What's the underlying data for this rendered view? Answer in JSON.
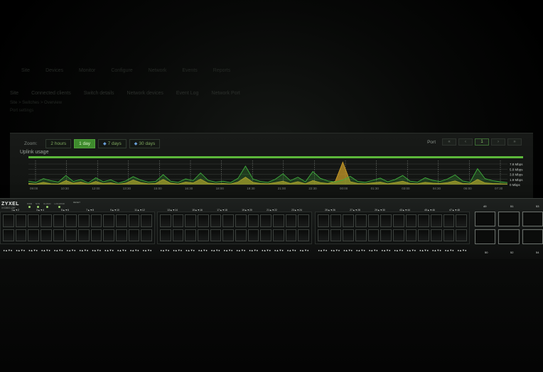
{
  "background_nav": {
    "items": [
      "Site",
      "Devices",
      "Monitor",
      "Configure",
      "Network",
      "Events",
      "Reports"
    ],
    "tabs": [
      "Site",
      "Connected clients",
      "Switch details",
      "Network devices",
      "Event Log",
      "Network Port"
    ],
    "crumb": "Site > Switches > Overview",
    "sub": "Port settings"
  },
  "panel": {
    "range_label": "Zoom:",
    "ranges": [
      {
        "label": "2 hours",
        "active": false,
        "icon": ""
      },
      {
        "label": "1 day",
        "active": true,
        "icon": ""
      },
      {
        "label": "7 days",
        "active": false,
        "icon": "lock-icon"
      },
      {
        "label": "30 days",
        "active": false,
        "icon": "lock-icon"
      }
    ],
    "port_label": "Port",
    "pager": [
      "«",
      "‹",
      "1",
      "›",
      "»"
    ],
    "selected_page": 2,
    "chart_title": "Uplink usage"
  },
  "chart_data": {
    "type": "area",
    "title": "Uplink usage",
    "x": [
      "09:00",
      "10:30",
      "12:00",
      "13:30",
      "15:00",
      "16:30",
      "18:00",
      "19:30",
      "21:00",
      "22:30",
      "00:00",
      "01:30",
      "03:00",
      "04:30",
      "06:00",
      "07:30"
    ],
    "y_ticks": [
      "7.8 Mbps",
      "5.8 Mbps",
      "3.8 Mbps",
      "1.9 Mbps",
      "0 Mbps"
    ],
    "ylim": [
      0,
      9
    ],
    "series": [
      {
        "name": "Upload",
        "color": "#3fae3c",
        "values": [
          1.2,
          0.8,
          2.1,
          1.4,
          0.9,
          3.2,
          1.1,
          1.8,
          0.6,
          2.4,
          1.0,
          1.7,
          0.5,
          1.3,
          2.8,
          1.6,
          0.9,
          1.1,
          3.5,
          1.2,
          0.8,
          2.0,
          1.4,
          4.1,
          1.5,
          0.9,
          1.2,
          0.7,
          2.2,
          6.5,
          2.0,
          1.1,
          0.8,
          1.9,
          3.8,
          1.4,
          2.6,
          1.0,
          4.6,
          2.2,
          1.3,
          0.9,
          1.6,
          2.9,
          1.1,
          0.8,
          1.5,
          2.3,
          1.0,
          1.8,
          3.2,
          1.2,
          0.9,
          2.4,
          1.5,
          1.1,
          2.0,
          3.4,
          1.3,
          0.8,
          5.6,
          2.1,
          1.4,
          1.0,
          0.7
        ]
      },
      {
        "name": "Download",
        "color": "#c79a27",
        "values": [
          0.4,
          0.2,
          0.8,
          0.3,
          0.2,
          1.4,
          0.5,
          0.9,
          0.2,
          1.1,
          0.4,
          0.6,
          0.1,
          0.5,
          1.6,
          0.7,
          0.3,
          0.4,
          1.8,
          0.5,
          0.2,
          0.9,
          0.6,
          1.9,
          0.5,
          0.3,
          0.4,
          0.2,
          0.9,
          2.6,
          0.8,
          0.4,
          0.3,
          0.7,
          1.2,
          0.4,
          1.0,
          0.3,
          1.4,
          0.7,
          0.4,
          1.2,
          7.9,
          1.0,
          0.4,
          0.3,
          0.6,
          0.9,
          0.3,
          0.7,
          1.2,
          0.4,
          0.3,
          0.8,
          0.5,
          0.4,
          0.7,
          1.3,
          0.4,
          0.3,
          1.8,
          0.6,
          0.4,
          0.3,
          0.2
        ]
      }
    ],
    "grid": true
  },
  "switch": {
    "brand": "ZYXEL",
    "model": "XS3800-28F",
    "leds": [
      "PWR",
      "SYS",
      "CLOUD",
      "LOCATOR"
    ],
    "reset_label": "RESET",
    "group1_top": [
      "1▲▼2",
      "3▲▼4",
      "5▲▼6",
      "7▲▼8",
      "9▲▼10",
      "11▲▼12"
    ],
    "group2_top": [
      "13▲▼14",
      "15▲▼16",
      "17▲▼18",
      "19▲▼20",
      "21▲▼22",
      "23▲▼24"
    ],
    "group3_top": [
      "25▲▼26",
      "27▲▼28",
      "29▲▼30",
      "31▲▼32",
      "33▲▼34",
      "35▲▼36"
    ],
    "group4_top": [
      "37▲▼38",
      "39▲▼40",
      "41▲▼42",
      "43▲▼44",
      "45▲▼46",
      "47▲▼48"
    ],
    "bottom_led": "●▲▼●",
    "uplink_numbers": [
      "49",
      "51",
      "53",
      "50",
      "52",
      "54"
    ]
  }
}
